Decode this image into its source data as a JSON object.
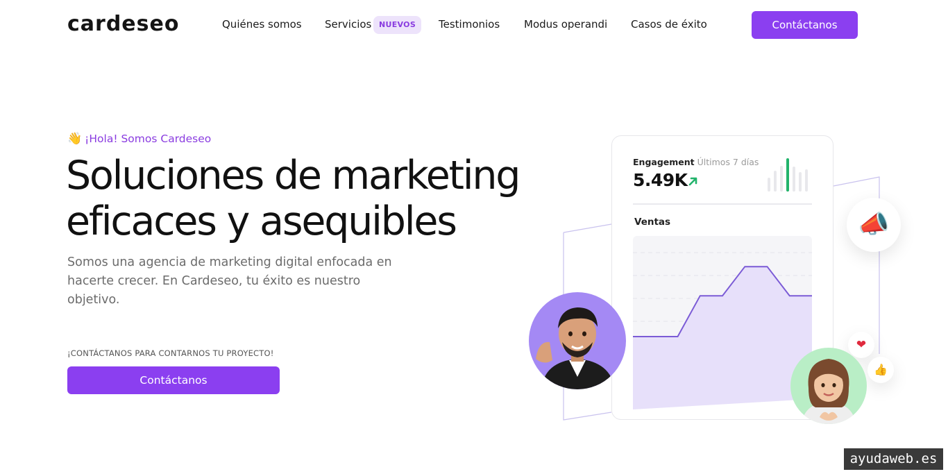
{
  "nav": {
    "logo": "cardeseo",
    "links": [
      {
        "label": "Quiénes somos"
      },
      {
        "label": "Servicios",
        "badge": "NUEVOS"
      },
      {
        "label": "Testimonios"
      },
      {
        "label": "Modus operandi"
      },
      {
        "label": "Casos de éxito"
      }
    ],
    "cta_label": "Contáctanos"
  },
  "hero": {
    "greeting_icon": "waving-hand",
    "greeting": "¡Hola! Somos Cardeseo",
    "headline_line1": "Soluciones de marketing",
    "headline_line2": "eficaces y asequibles",
    "lead": "Somos una agencia de marketing digital enfocada en hacerte crecer. En Cardeseo, tu éxito es nuestro objetivo.",
    "cta_caption": "¡CONTÁCTANOS PARA CONTARNOS TU PROYECTO!",
    "cta_label": "Contáctanos"
  },
  "illustration": {
    "engagement_label": "Engagement",
    "engagement_period": "Últimos 7 días",
    "engagement_value": "5.49K",
    "trend": "up",
    "sales_label": "Ventas",
    "sales_trend": [
      0.0,
      0.0,
      0.0,
      0.42,
      0.42,
      0.72,
      0.72,
      0.42,
      0.42
    ],
    "icons": [
      "megaphone-icon",
      "heart-icon",
      "thumbs-up-icon"
    ],
    "accent": "#8b3ff0",
    "positive": "#22b36b"
  },
  "watermark": "ayudaweb.es"
}
